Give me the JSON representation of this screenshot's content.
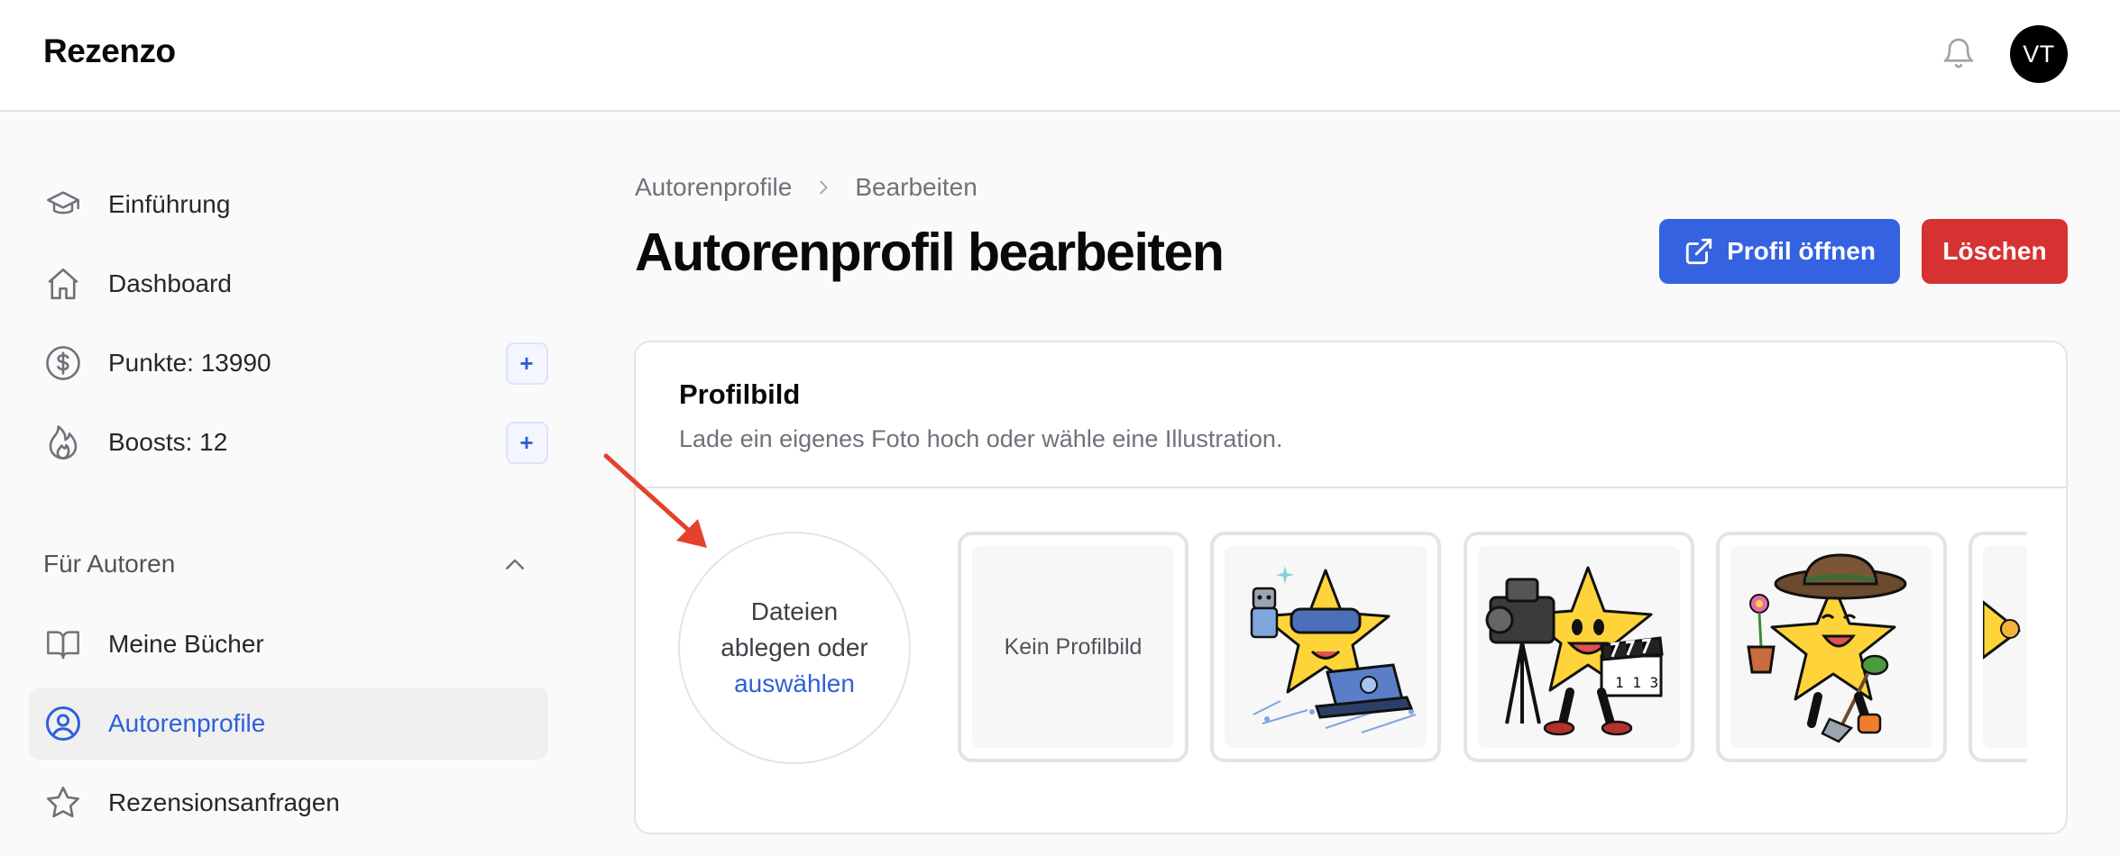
{
  "header": {
    "brand": "Rezenzo",
    "avatar_initials": "VT",
    "bell_icon": "bell-icon"
  },
  "sidebar": {
    "items": [
      {
        "label": "Einführung",
        "icon": "graduation-cap-icon"
      },
      {
        "label": "Dashboard",
        "icon": "home-icon"
      },
      {
        "label": "Punkte: 13990",
        "icon": "dollar-circle-icon",
        "action": "+"
      },
      {
        "label": "Boosts: 12",
        "icon": "flame-icon",
        "action": "+"
      }
    ],
    "section": {
      "title": "Für Autoren",
      "items": [
        {
          "label": "Meine Bücher",
          "icon": "book-open-icon"
        },
        {
          "label": "Autorenprofile",
          "icon": "user-circle-icon",
          "active": true
        },
        {
          "label": "Rezensionsanfragen",
          "icon": "star-icon"
        }
      ]
    }
  },
  "breadcrumb": {
    "parent": "Autorenprofile",
    "current": "Bearbeiten"
  },
  "page": {
    "title": "Autorenprofil bearbeiten",
    "open_button": "Profil öffnen",
    "delete_button": "Löschen"
  },
  "card": {
    "title": "Profilbild",
    "description": "Lade ein eigenes Foto hoch oder wähle eine Illustration.",
    "dropzone": {
      "line1": "Dateien",
      "line2": "ablegen oder",
      "link": "auswählen"
    },
    "options": [
      {
        "label": "Kein Profilbild"
      },
      {
        "illustration": "star-vr-laptop"
      },
      {
        "illustration": "star-film-camera"
      },
      {
        "illustration": "star-gardener"
      },
      {
        "illustration": "star-partial"
      }
    ]
  },
  "colors": {
    "accent": "#3462e0",
    "danger": "#d63232",
    "active_nav_text": "#2f5fd8",
    "annotation_arrow": "#e5412c"
  }
}
